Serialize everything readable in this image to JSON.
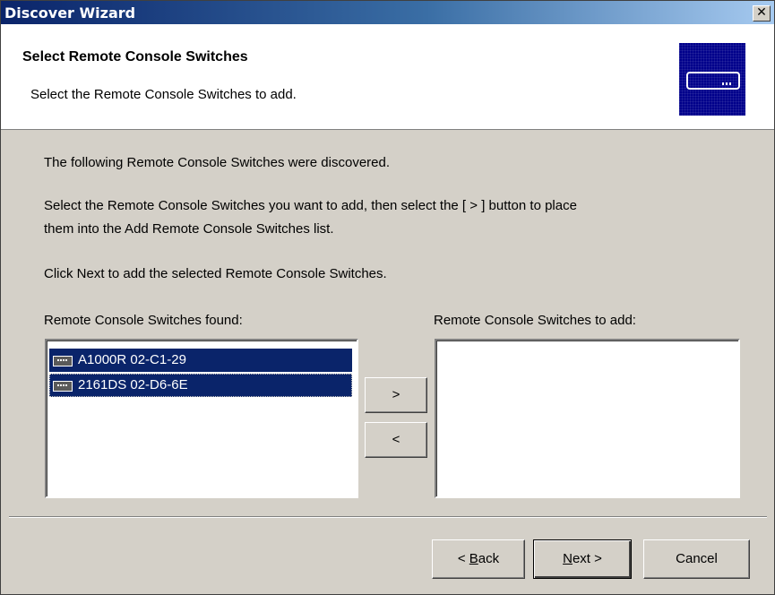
{
  "window": {
    "title": "Discover Wizard",
    "close_glyph": "✕"
  },
  "header": {
    "title": "Select Remote Console Switches",
    "subtitle": "Select the Remote Console Switches to add.",
    "icon": "network-switch-icon"
  },
  "body": {
    "line1": "The following Remote Console Switches were discovered.",
    "line2a": "Select the Remote Console Switches you want to add, then select the [ > ] button to place",
    "line2b": "them into the Add Remote Console Switches list.",
    "line3": "Click Next to add the selected Remote Console Switches."
  },
  "found": {
    "label": "Remote Console Switches found:",
    "items": [
      {
        "label": "A1000R 02-C1-29",
        "icon": "switch-device-icon",
        "selected": true
      },
      {
        "label": "2161DS 02-D6-6E",
        "icon": "switch-device-icon",
        "selected": true
      }
    ]
  },
  "to_add": {
    "label": "Remote Console Switches to add:",
    "items": []
  },
  "transfer": {
    "add_label": ">",
    "remove_label": "<"
  },
  "buttons": {
    "back_prefix": "< ",
    "back_hotkey": "B",
    "back_rest": "ack",
    "next_hotkey": "N",
    "next_rest": "ext >",
    "cancel": "Cancel"
  },
  "colors": {
    "title_bar": "#0a246a",
    "selection": "#0a246a",
    "header_icon_bg": "#00008b",
    "dialog_bg": "#d4d0c8"
  }
}
